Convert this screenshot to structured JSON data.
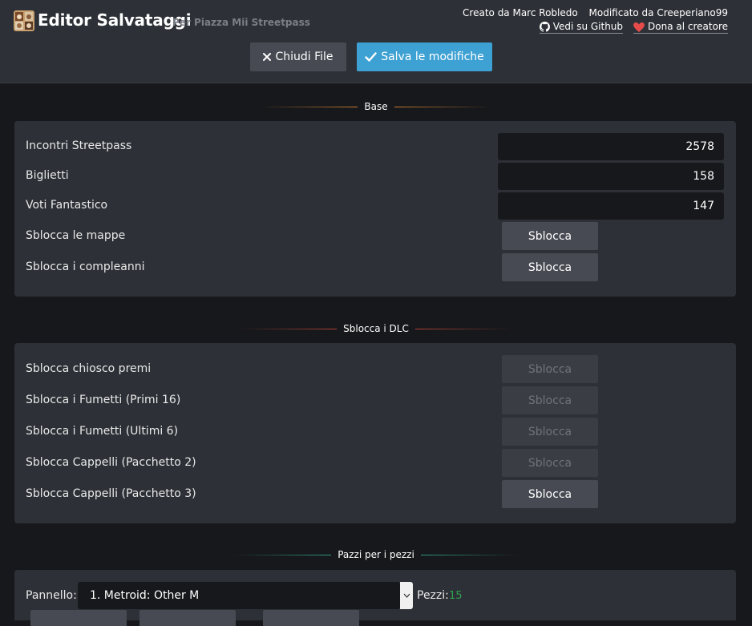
{
  "header": {
    "title": "Editor Salvataggi",
    "subtitle": "Per Piazza Mii Streetpass",
    "created_by": "Creato da Marc Robledo",
    "modified_by": "Modificato da Creeperiano99",
    "github_link": "Vedi su Github",
    "donate_link": "Dona al creatore",
    "close_button": "Chiudi File",
    "save_button": "Salva le modifiche",
    "colors": {
      "save_accent": "#3ea1d3",
      "donate_heart": "#e54b4b"
    }
  },
  "sections": {
    "base": {
      "title": "Base",
      "fields": [
        {
          "label": "Incontri Streetpass",
          "value": "2578"
        },
        {
          "label": "Biglietti",
          "value": "158"
        },
        {
          "label": "Voti Fantastico",
          "value": "147"
        }
      ],
      "unlocks": [
        {
          "label": "Sblocca le mappe",
          "button": "Sblocca",
          "enabled": true
        },
        {
          "label": "Sblocca i compleanni",
          "button": "Sblocca",
          "enabled": true
        }
      ]
    },
    "dlc": {
      "title": "Sblocca i DLC",
      "unlocks": [
        {
          "label": "Sblocca chiosco premi",
          "button": "Sblocca",
          "enabled": false
        },
        {
          "label": "Sblocca i Fumetti (Primi 16)",
          "button": "Sblocca",
          "enabled": false
        },
        {
          "label": "Sblocca i Fumetti (Ultimi 6)",
          "button": "Sblocca",
          "enabled": false
        },
        {
          "label": "Sblocca Cappelli (Pacchetto 2)",
          "button": "Sblocca",
          "enabled": false
        },
        {
          "label": "Sblocca Cappelli (Pacchetto 3)",
          "button": "Sblocca",
          "enabled": true
        }
      ]
    },
    "pieces": {
      "title": "Pazzi per i pezzi",
      "panel_label": "Pannello:",
      "panel_selected": "1. Metroid: Other M",
      "pieces_label": "Pezzi:",
      "pieces_count": "15",
      "pieces_count_color": "#2fa350"
    }
  }
}
